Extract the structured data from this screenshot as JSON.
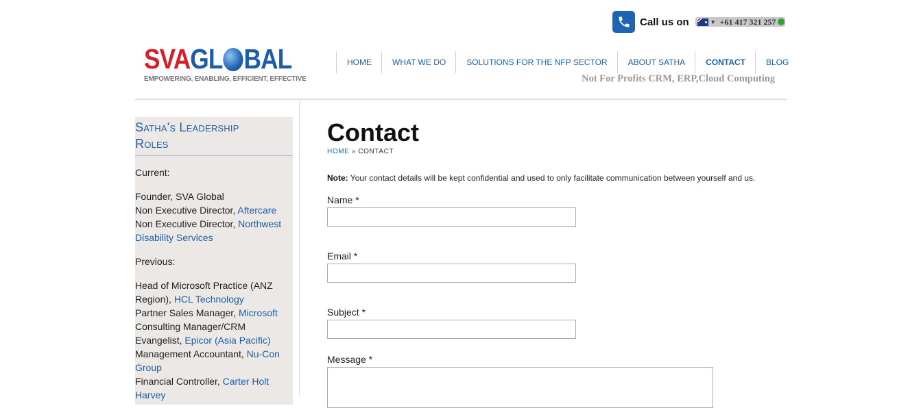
{
  "header": {
    "call_label": "Call us on",
    "phone": "+61 417 321 257",
    "logo": {
      "left": "SVA",
      "right_pre": "GL",
      "right_post": "BAL",
      "tagline": "EMPOWERING, ENABLING, EFFICIENT, EFFECTIVE"
    },
    "nav": [
      "HOME",
      "WHAT WE DO",
      "SOLUTIONS FOR THE NFP SECTOR",
      "ABOUT SATHA",
      "CONTACT",
      "BLOG"
    ],
    "subtitle": "Not For Profits CRM, ERP,Cloud Computing"
  },
  "sidebar": {
    "title_line1": "Satha's Leadership",
    "title_line2": "Roles",
    "current_label": "Current:",
    "founder": "Founder, SVA Global",
    "ned1_prefix": "Non Executive Director, ",
    "ned1_link": "Aftercare",
    "ned2_prefix": "Non Executive Director, ",
    "ned2_link": "Northwest Disability Services",
    "previous_label": "Previous:",
    "p1_prefix": "Head of Microsoft Practice (ANZ Region), ",
    "p1_link": "HCL Technology",
    "p2_prefix": "Partner Sales Manager, ",
    "p2_link": "Microsoft",
    "p3_prefix": "Consulting Manager/CRM Evangelist, ",
    "p3_link": "Epicor (Asia Pacific)",
    "p4_prefix": "Management Accountant, ",
    "p4_link": "Nu-Con Group",
    "p5_prefix": "Financial Controller, ",
    "p5_link": "Carter Holt Harvey"
  },
  "main": {
    "title": "Contact",
    "breadcrumb_home": "HOME",
    "breadcrumb_sep": " » ",
    "breadcrumb_current": "CONTACT",
    "note_label": "Note:",
    "note_text": " Your contact details will be kept confidential and used to only facilitate communication between yourself and us.",
    "fields": {
      "name": "Name *",
      "email": "Email *",
      "subject": "Subject *",
      "message": "Message *"
    }
  }
}
